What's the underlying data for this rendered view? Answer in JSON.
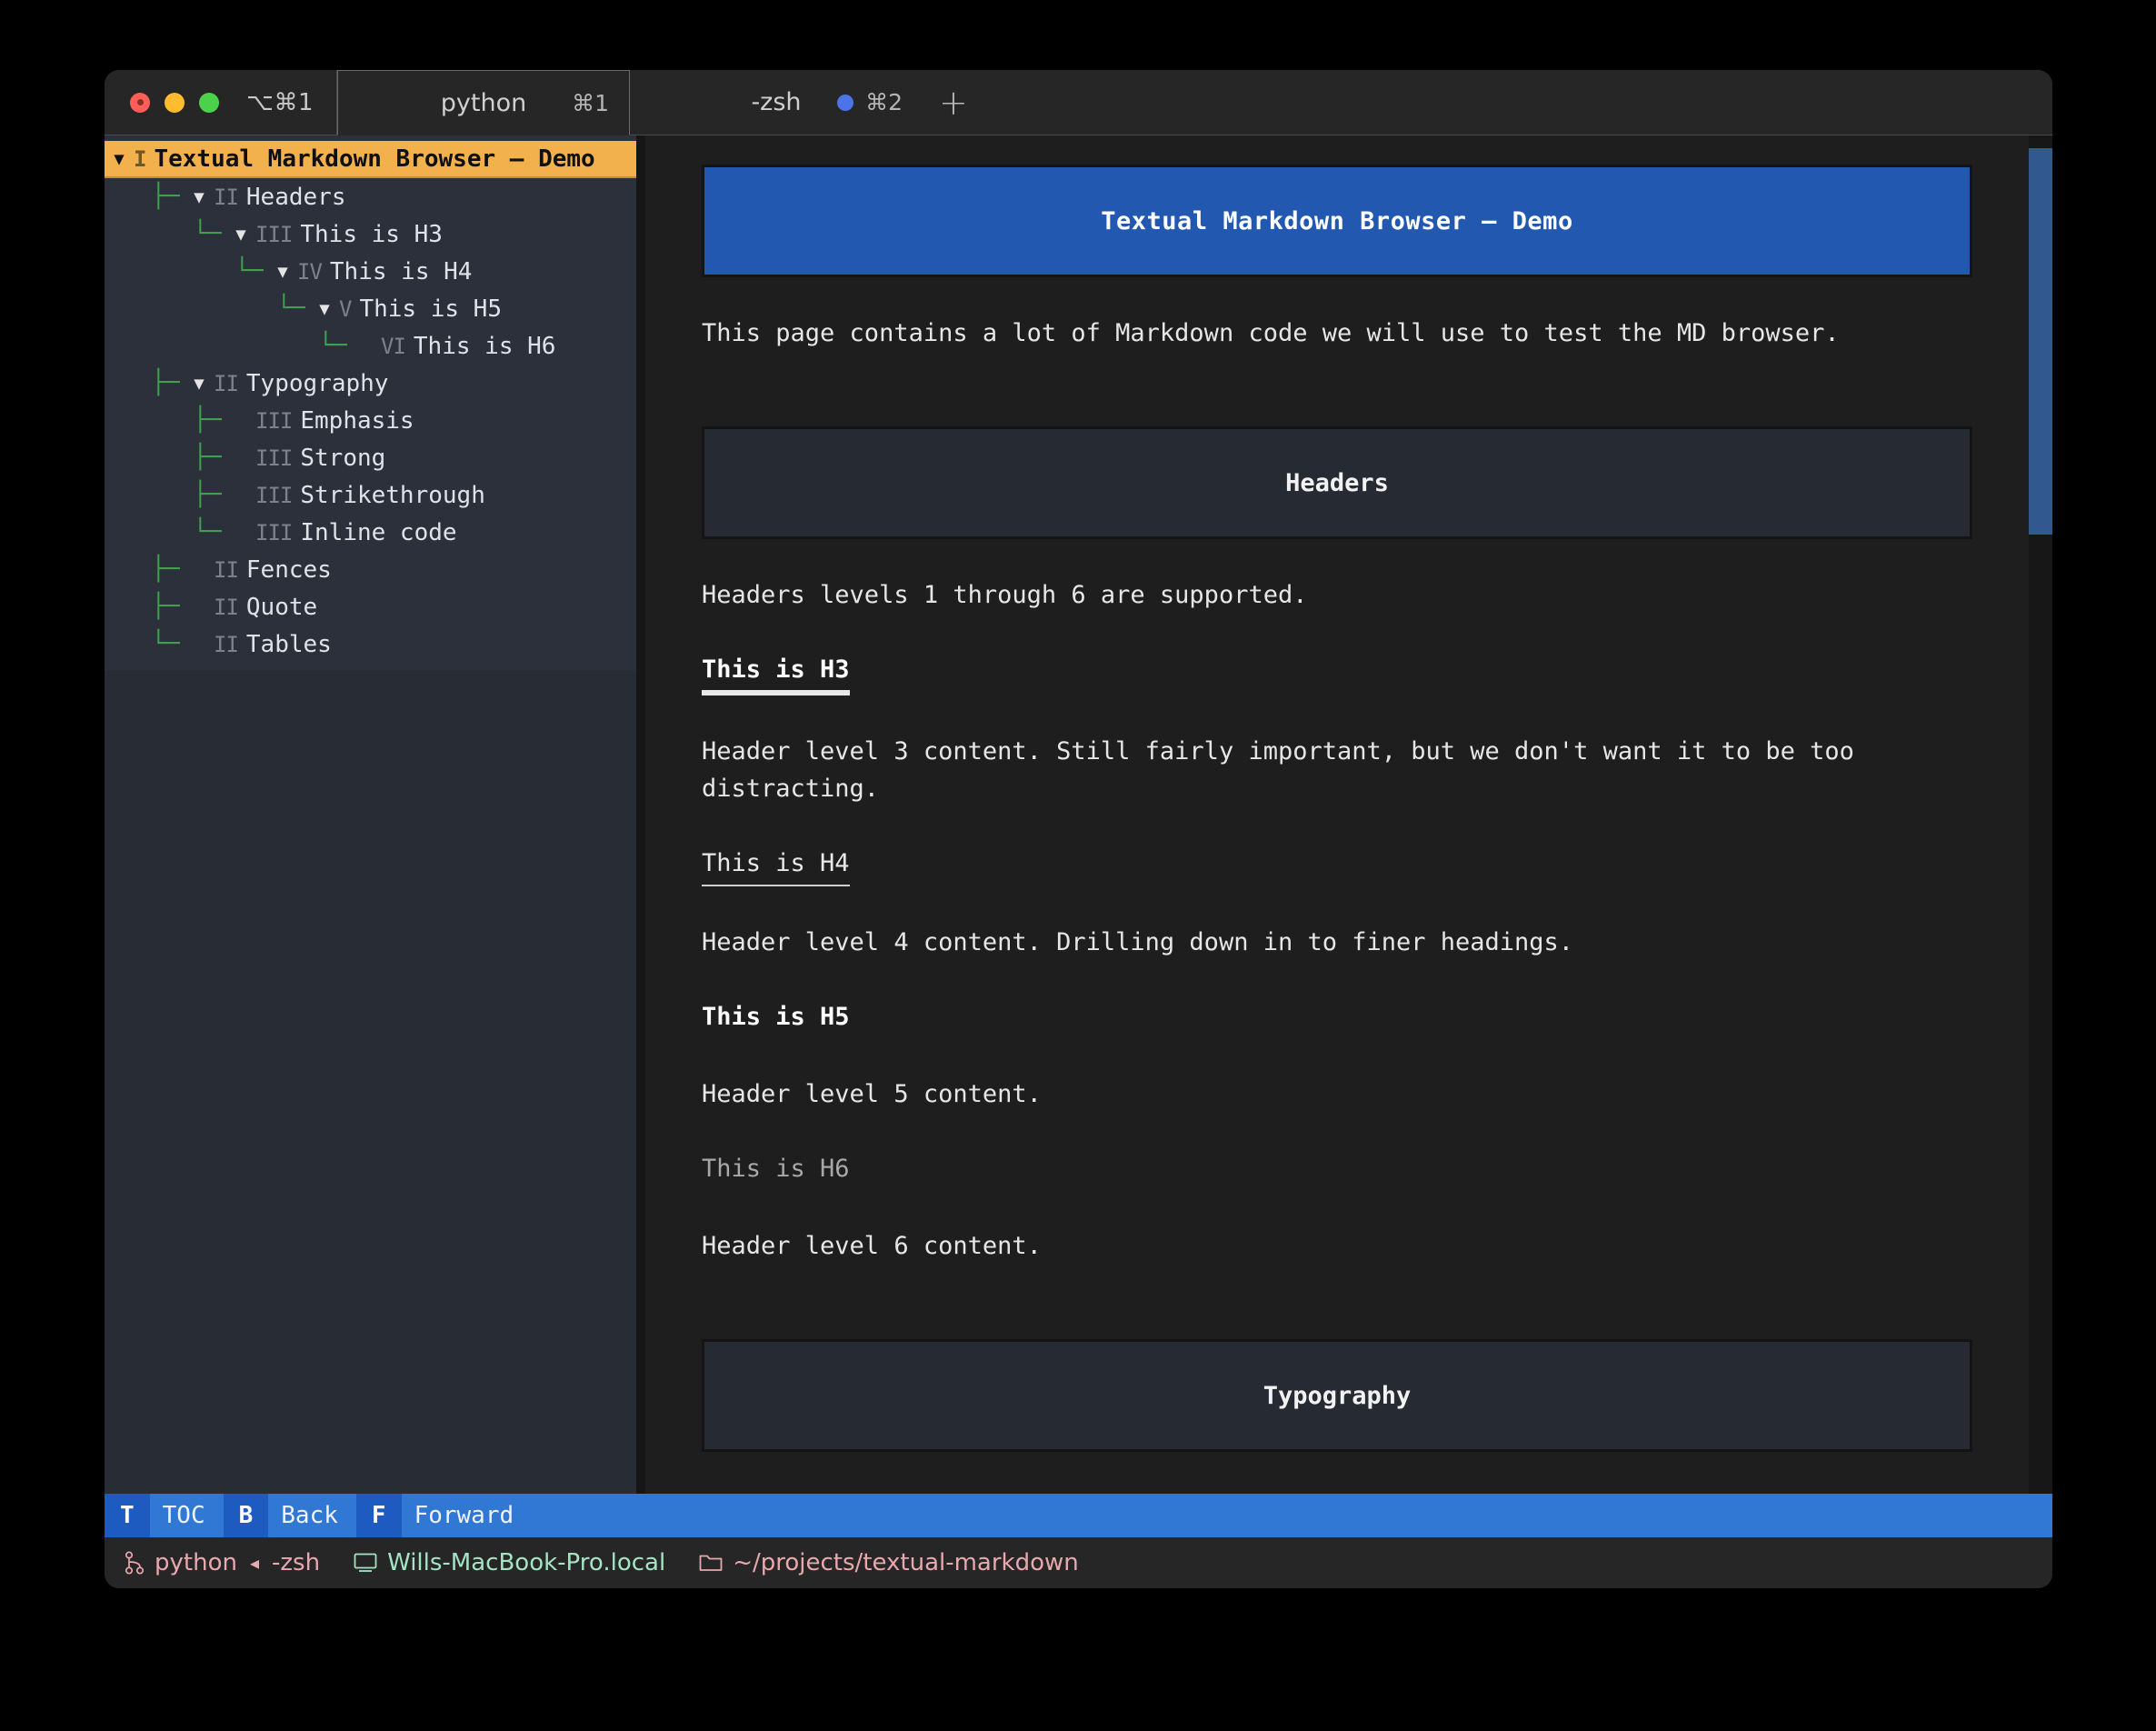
{
  "window": {
    "traffic_shortcut": "⌥⌘1",
    "tabs": [
      {
        "title": "python",
        "shortcut": "⌘1",
        "active": true,
        "has_dot": false
      },
      {
        "title": "-zsh",
        "shortcut": "⌘2",
        "active": false,
        "has_dot": true
      }
    ],
    "new_tab_label": "+"
  },
  "sidebar": {
    "tree": [
      {
        "label": "Textual Markdown Browser — Demo",
        "mark": "I",
        "caret": "▼",
        "indent": 0,
        "selected": true,
        "guide": ""
      },
      {
        "label": "Headers",
        "mark": "II",
        "caret": "▼",
        "indent": 1,
        "selected": false,
        "guide": "├─"
      },
      {
        "label": "This is H3",
        "mark": "III",
        "caret": "▼",
        "indent": 2,
        "selected": false,
        "guide": "└─"
      },
      {
        "label": "This is H4",
        "mark": "IV",
        "caret": "▼",
        "indent": 3,
        "selected": false,
        "guide": "└─"
      },
      {
        "label": "This is H5",
        "mark": "V",
        "caret": "▼",
        "indent": 4,
        "selected": false,
        "guide": "└─"
      },
      {
        "label": "This is H6",
        "mark": "VI",
        "caret": "",
        "indent": 5,
        "selected": false,
        "guide": "└─"
      },
      {
        "label": "Typography",
        "mark": "II",
        "caret": "▼",
        "indent": 1,
        "selected": false,
        "guide": "├─"
      },
      {
        "label": "Emphasis",
        "mark": "III",
        "caret": "",
        "indent": 2,
        "selected": false,
        "guide": "├─"
      },
      {
        "label": "Strong",
        "mark": "III",
        "caret": "",
        "indent": 2,
        "selected": false,
        "guide": "├─"
      },
      {
        "label": "Strikethrough",
        "mark": "III",
        "caret": "",
        "indent": 2,
        "selected": false,
        "guide": "├─"
      },
      {
        "label": "Inline code",
        "mark": "III",
        "caret": "",
        "indent": 2,
        "selected": false,
        "guide": "└─"
      },
      {
        "label": "Fences",
        "mark": "II",
        "caret": "",
        "indent": 1,
        "selected": false,
        "guide": "├─"
      },
      {
        "label": "Quote",
        "mark": "II",
        "caret": "",
        "indent": 1,
        "selected": false,
        "guide": "├─"
      },
      {
        "label": "Tables",
        "mark": "II",
        "caret": "",
        "indent": 1,
        "selected": false,
        "guide": "└─"
      }
    ]
  },
  "document": {
    "h1": "Textual Markdown Browser — Demo",
    "intro": "This page contains a lot of Markdown code we will use to test the MD browser.",
    "h2_headers": "Headers",
    "headers_intro": "Headers levels 1 through 6 are supported.",
    "h3": "This is H3",
    "h3_body_line1": "Header level 3 content. Still fairly important, but we don't want it to be too",
    "h3_body_line2": "distracting.",
    "h4": "This is H4",
    "h4_body": "Header level 4 content. Drilling down in to finer headings.",
    "h5": "This is H5",
    "h5_body": "Header level 5 content.",
    "h6": "This is H6",
    "h6_body": "Header level 6 content.",
    "h2_typography": "Typography"
  },
  "keybar": [
    {
      "key": "T",
      "desc": "TOC"
    },
    {
      "key": "B",
      "desc": "Back"
    },
    {
      "key": "F",
      "desc": "Forward"
    }
  ],
  "statusline": {
    "branch": "python",
    "separator": "◂",
    "shell": "-zsh",
    "host": "Wills-MacBook-Pro.local",
    "path": "~/projects/textual-markdown"
  },
  "colors": {
    "accent_blue": "#2258b0",
    "keybar_blue": "#3178d4",
    "key_blue": "#1d5bc1",
    "selection_orange": "#f3b14e",
    "tree_guide_green": "#3f9e50",
    "panel": "#282c34",
    "content_bg": "#1e1e1e"
  }
}
